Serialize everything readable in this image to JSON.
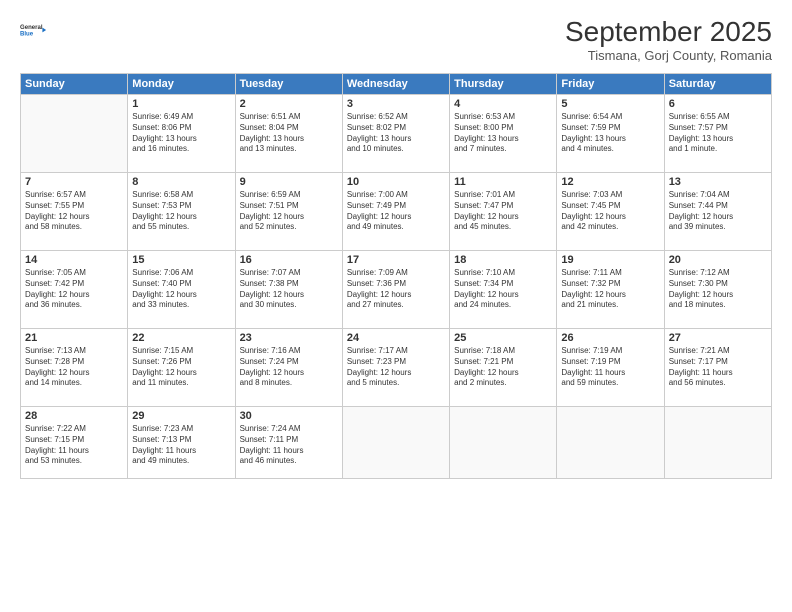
{
  "header": {
    "logo_line1": "General",
    "logo_line2": "Blue",
    "month": "September 2025",
    "location": "Tismana, Gorj County, Romania"
  },
  "weekdays": [
    "Sunday",
    "Monday",
    "Tuesday",
    "Wednesday",
    "Thursday",
    "Friday",
    "Saturday"
  ],
  "weeks": [
    [
      {
        "num": "",
        "info": ""
      },
      {
        "num": "1",
        "info": "Sunrise: 6:49 AM\nSunset: 8:06 PM\nDaylight: 13 hours\nand 16 minutes."
      },
      {
        "num": "2",
        "info": "Sunrise: 6:51 AM\nSunset: 8:04 PM\nDaylight: 13 hours\nand 13 minutes."
      },
      {
        "num": "3",
        "info": "Sunrise: 6:52 AM\nSunset: 8:02 PM\nDaylight: 13 hours\nand 10 minutes."
      },
      {
        "num": "4",
        "info": "Sunrise: 6:53 AM\nSunset: 8:00 PM\nDaylight: 13 hours\nand 7 minutes."
      },
      {
        "num": "5",
        "info": "Sunrise: 6:54 AM\nSunset: 7:59 PM\nDaylight: 13 hours\nand 4 minutes."
      },
      {
        "num": "6",
        "info": "Sunrise: 6:55 AM\nSunset: 7:57 PM\nDaylight: 13 hours\nand 1 minute."
      }
    ],
    [
      {
        "num": "7",
        "info": "Sunrise: 6:57 AM\nSunset: 7:55 PM\nDaylight: 12 hours\nand 58 minutes."
      },
      {
        "num": "8",
        "info": "Sunrise: 6:58 AM\nSunset: 7:53 PM\nDaylight: 12 hours\nand 55 minutes."
      },
      {
        "num": "9",
        "info": "Sunrise: 6:59 AM\nSunset: 7:51 PM\nDaylight: 12 hours\nand 52 minutes."
      },
      {
        "num": "10",
        "info": "Sunrise: 7:00 AM\nSunset: 7:49 PM\nDaylight: 12 hours\nand 49 minutes."
      },
      {
        "num": "11",
        "info": "Sunrise: 7:01 AM\nSunset: 7:47 PM\nDaylight: 12 hours\nand 45 minutes."
      },
      {
        "num": "12",
        "info": "Sunrise: 7:03 AM\nSunset: 7:45 PM\nDaylight: 12 hours\nand 42 minutes."
      },
      {
        "num": "13",
        "info": "Sunrise: 7:04 AM\nSunset: 7:44 PM\nDaylight: 12 hours\nand 39 minutes."
      }
    ],
    [
      {
        "num": "14",
        "info": "Sunrise: 7:05 AM\nSunset: 7:42 PM\nDaylight: 12 hours\nand 36 minutes."
      },
      {
        "num": "15",
        "info": "Sunrise: 7:06 AM\nSunset: 7:40 PM\nDaylight: 12 hours\nand 33 minutes."
      },
      {
        "num": "16",
        "info": "Sunrise: 7:07 AM\nSunset: 7:38 PM\nDaylight: 12 hours\nand 30 minutes."
      },
      {
        "num": "17",
        "info": "Sunrise: 7:09 AM\nSunset: 7:36 PM\nDaylight: 12 hours\nand 27 minutes."
      },
      {
        "num": "18",
        "info": "Sunrise: 7:10 AM\nSunset: 7:34 PM\nDaylight: 12 hours\nand 24 minutes."
      },
      {
        "num": "19",
        "info": "Sunrise: 7:11 AM\nSunset: 7:32 PM\nDaylight: 12 hours\nand 21 minutes."
      },
      {
        "num": "20",
        "info": "Sunrise: 7:12 AM\nSunset: 7:30 PM\nDaylight: 12 hours\nand 18 minutes."
      }
    ],
    [
      {
        "num": "21",
        "info": "Sunrise: 7:13 AM\nSunset: 7:28 PM\nDaylight: 12 hours\nand 14 minutes."
      },
      {
        "num": "22",
        "info": "Sunrise: 7:15 AM\nSunset: 7:26 PM\nDaylight: 12 hours\nand 11 minutes."
      },
      {
        "num": "23",
        "info": "Sunrise: 7:16 AM\nSunset: 7:24 PM\nDaylight: 12 hours\nand 8 minutes."
      },
      {
        "num": "24",
        "info": "Sunrise: 7:17 AM\nSunset: 7:23 PM\nDaylight: 12 hours\nand 5 minutes."
      },
      {
        "num": "25",
        "info": "Sunrise: 7:18 AM\nSunset: 7:21 PM\nDaylight: 12 hours\nand 2 minutes."
      },
      {
        "num": "26",
        "info": "Sunrise: 7:19 AM\nSunset: 7:19 PM\nDaylight: 11 hours\nand 59 minutes."
      },
      {
        "num": "27",
        "info": "Sunrise: 7:21 AM\nSunset: 7:17 PM\nDaylight: 11 hours\nand 56 minutes."
      }
    ],
    [
      {
        "num": "28",
        "info": "Sunrise: 7:22 AM\nSunset: 7:15 PM\nDaylight: 11 hours\nand 53 minutes."
      },
      {
        "num": "29",
        "info": "Sunrise: 7:23 AM\nSunset: 7:13 PM\nDaylight: 11 hours\nand 49 minutes."
      },
      {
        "num": "30",
        "info": "Sunrise: 7:24 AM\nSunset: 7:11 PM\nDaylight: 11 hours\nand 46 minutes."
      },
      {
        "num": "",
        "info": ""
      },
      {
        "num": "",
        "info": ""
      },
      {
        "num": "",
        "info": ""
      },
      {
        "num": "",
        "info": ""
      }
    ]
  ]
}
